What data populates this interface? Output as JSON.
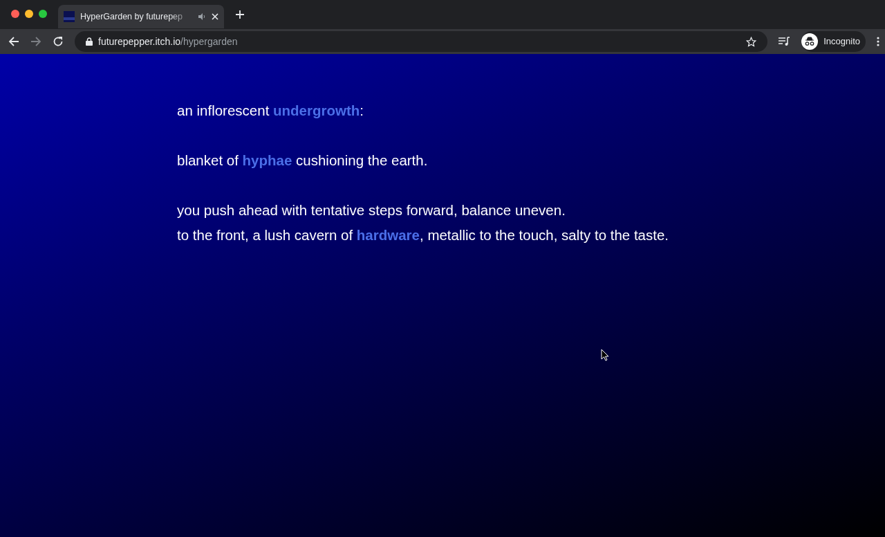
{
  "tab": {
    "title": "HyperGarden by futurepep",
    "selected": true
  },
  "address": {
    "host": "futurepepper.itch.io",
    "path": "/hypergarden"
  },
  "profile": {
    "label": "Incognito"
  },
  "passages": [
    {
      "lines": [
        [
          {
            "kind": "text",
            "text": "an inflorescent "
          },
          {
            "kind": "link",
            "text": "undergrowth"
          },
          {
            "kind": "text",
            "text": ":"
          }
        ]
      ]
    },
    {
      "lines": [
        [
          {
            "kind": "text",
            "text": "blanket of "
          },
          {
            "kind": "link",
            "text": "hyphae"
          },
          {
            "kind": "text",
            "text": " cushioning the earth."
          }
        ]
      ]
    },
    {
      "lines": [
        [
          {
            "kind": "text",
            "text": "you push ahead with tentative steps forward, balance uneven."
          }
        ],
        [
          {
            "kind": "text",
            "text": "to the front, a lush cavern of "
          },
          {
            "kind": "link",
            "text": "hardware"
          },
          {
            "kind": "text",
            "text": ", metallic to the touch, salty to the taste."
          }
        ]
      ]
    }
  ]
}
